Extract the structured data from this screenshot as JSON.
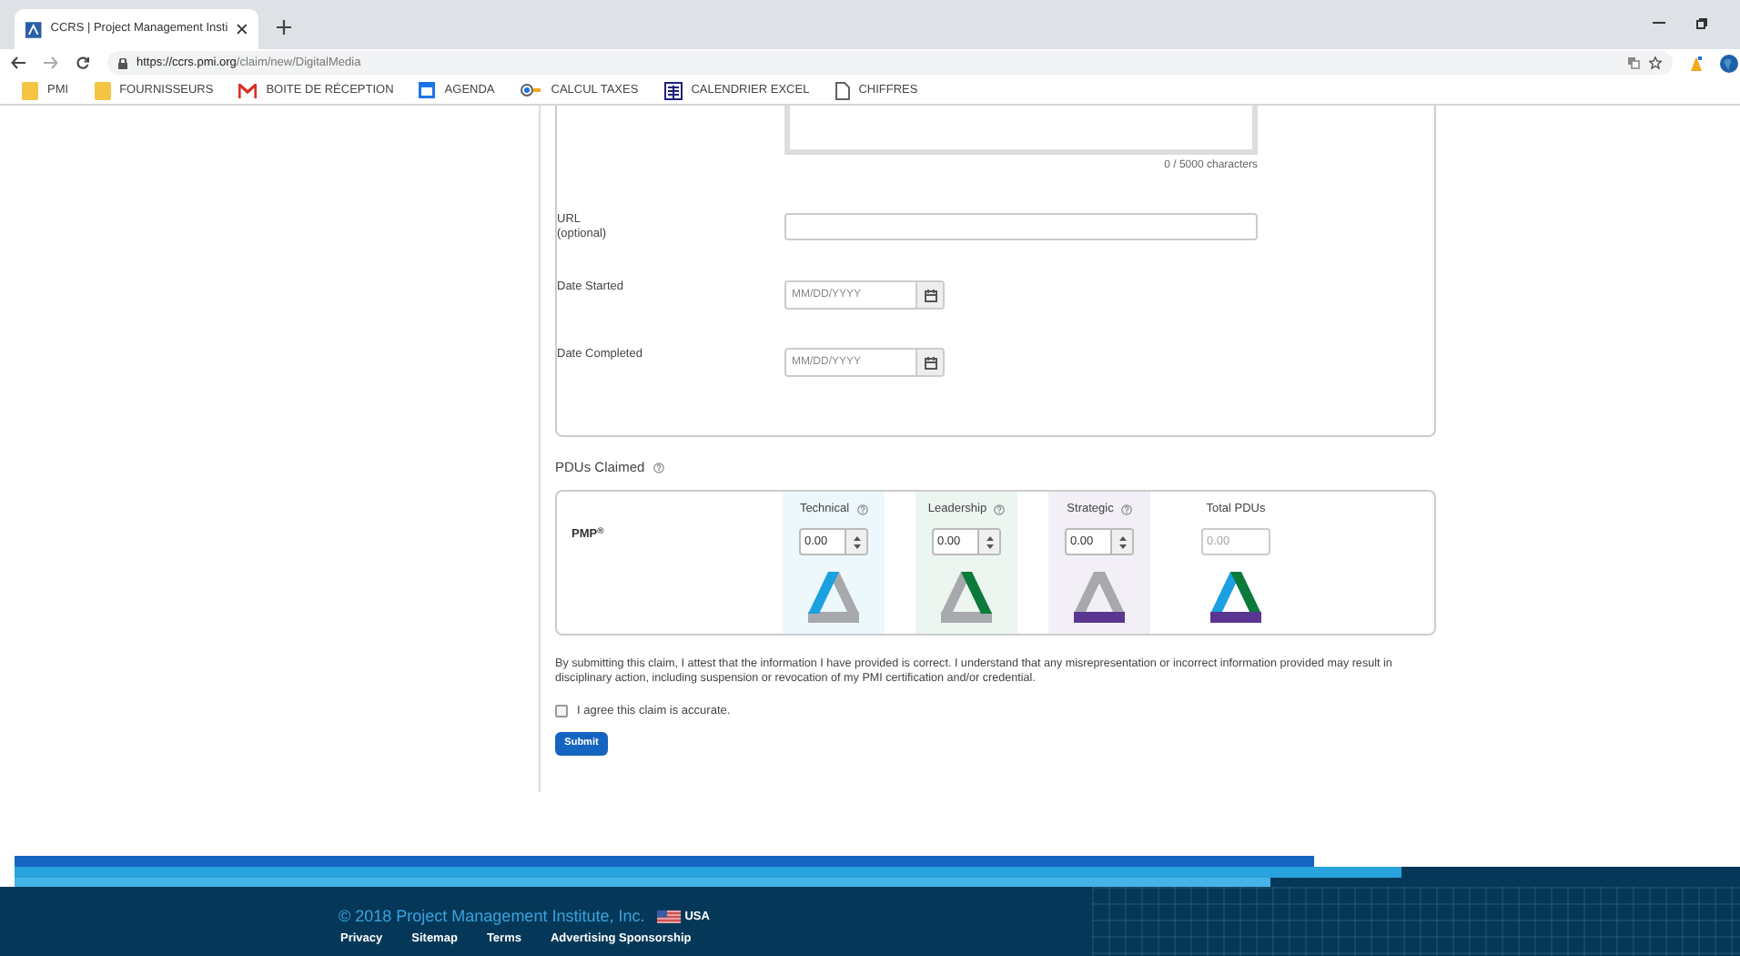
{
  "browser": {
    "tab": {
      "title": "CCRS | Project Management Insti",
      "selected": true
    },
    "url": {
      "host": "https://ccrs.pmi.org",
      "path": "/claim/new/DigitalMedia"
    },
    "bookmarks": [
      {
        "label": "PMI",
        "kind": "folder"
      },
      {
        "label": "FOURNISSEURS",
        "kind": "folder"
      },
      {
        "label": "BOITE DE RÉCEPTION",
        "kind": "mail"
      },
      {
        "label": "AGENDA",
        "kind": "calendar"
      },
      {
        "label": "CALCUL TAXES",
        "kind": "toggle"
      },
      {
        "label": "CALENDRIER EXCEL",
        "kind": "spreadsheet"
      },
      {
        "label": "CHIFFRES",
        "kind": "page"
      }
    ]
  },
  "form": {
    "character_count": "0 / 5000 characters",
    "fields": [
      {
        "label": "URL",
        "note": "(optional)",
        "kind": "text"
      },
      {
        "label": "Date Started",
        "placeholder": "MM/DD/YYYY",
        "kind": "date"
      },
      {
        "label": "Date Completed",
        "placeholder": "MM/DD/YYYY",
        "kind": "date"
      }
    ]
  },
  "pdus": {
    "title": "PDUs Claimed",
    "row_label": "PMP$^{®}$",
    "columns": [
      {
        "label": "Technical",
        "value": "0.00",
        "kind": "spinner",
        "color": "#1ba0e1"
      },
      {
        "label": "Leadership",
        "value": "0.00",
        "kind": "spinner",
        "color": "#0b7a3b"
      },
      {
        "label": "Strategic",
        "value": "0.00",
        "kind": "spinner",
        "color": "#5a3592"
      },
      {
        "label": "Total PDUs",
        "placeholder": "0.00",
        "kind": "total"
      }
    ]
  },
  "disclaimer": "By submitting this claim, I attest that the information I have provided is correct. I understand that any misrepresentation or incorrect information provided may result in disciplinary action, including suspension or revocation of my PMI certification and/or credential.",
  "agree": {
    "label": "I agree this claim is accurate.",
    "checked": false
  },
  "submit": "Submit",
  "footer": {
    "copyright": "© 2018 Project Management Institute, Inc.",
    "country": "USA",
    "links": [
      "Privacy",
      "Sitemap",
      "Terms",
      "Advertising Sponsorship"
    ]
  }
}
